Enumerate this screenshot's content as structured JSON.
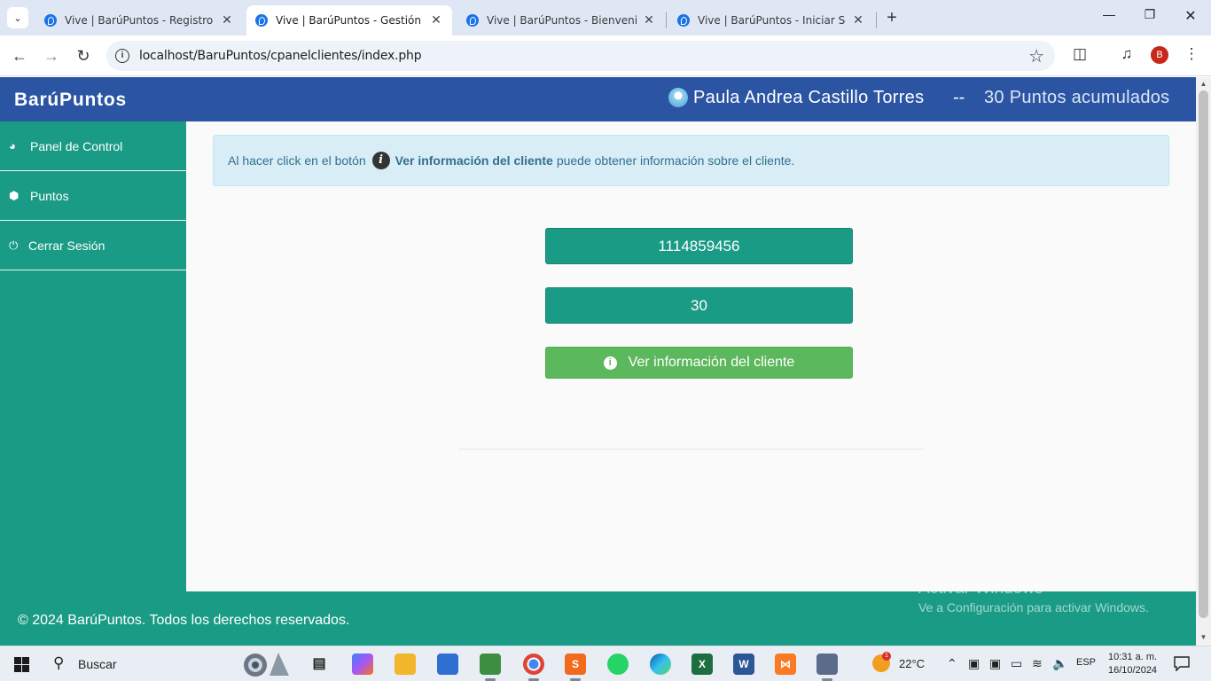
{
  "browser": {
    "tabs": [
      {
        "title": "Vive | BarúPuntos - Registro de",
        "active": false
      },
      {
        "title": "Vive | BarúPuntos - Gestión de",
        "active": true
      },
      {
        "title": "Vive | BarúPuntos - Bienvenido",
        "active": false
      },
      {
        "title": "Vive | BarúPuntos - Iniciar Sesió",
        "active": false
      }
    ],
    "url": "localhost/BaruPuntos/cpanelclientes/index.php",
    "profile_initial": "B"
  },
  "header": {
    "brand": "BarúPuntos",
    "user_name": "Paula Andrea Castillo Torres",
    "separator": "--",
    "points_label": "30 Puntos acumulados"
  },
  "sidebar": {
    "items": [
      {
        "label": "Panel de Control",
        "icon": "dashboard-icon"
      },
      {
        "label": "Puntos",
        "icon": "cube-icon"
      },
      {
        "label": "Cerrar Sesión",
        "icon": "power-icon"
      }
    ]
  },
  "alert": {
    "prefix": "Al hacer click en el botón",
    "bold": "Ver información del cliente",
    "suffix": "puede obtener información sobre el cliente."
  },
  "client": {
    "document": "1114859456",
    "points": "30",
    "info_button": "Ver información del cliente"
  },
  "footer": {
    "text": "© 2024 BarúPuntos. Todos los derechos reservados.",
    "activate_title": "Activar Windows",
    "activate_sub": "Ve a Configuración para activar Windows."
  },
  "taskbar": {
    "search": "Buscar",
    "weather_temp": "22°C",
    "weather_badge": "1",
    "lang": "ESP",
    "time": "10:31 a. m.",
    "date": "16/10/2024"
  },
  "colors": {
    "header": "#2b55a3",
    "teal": "#1a9b85",
    "green_button": "#5cb85c",
    "alert_bg": "#d9edf7"
  }
}
